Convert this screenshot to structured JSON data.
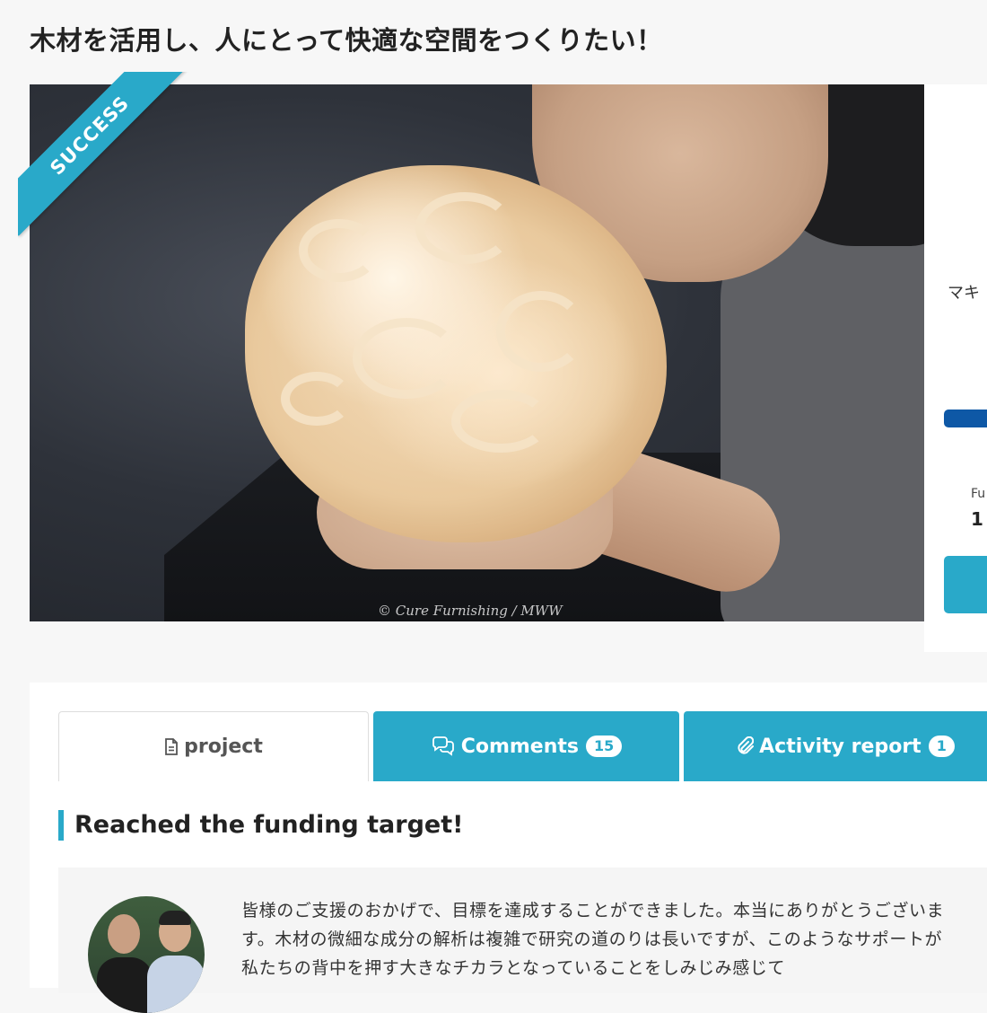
{
  "page": {
    "title": "木材を活用し、人にとって快適な空間をつくりたい！"
  },
  "hero": {
    "ribbon_label": "SUCCESS",
    "photo_credit": "© Cure Furnishing / MWW"
  },
  "side_panel": {
    "owner_partial": "マキ",
    "funding_label_partial": "Fu",
    "funding_value_partial": "1",
    "progress_bar_color": "#0e58a6"
  },
  "tabs": [
    {
      "label": "project",
      "icon": "document-icon",
      "active": true
    },
    {
      "label": "Comments",
      "icon": "comments-icon",
      "badge": "15",
      "active": false
    },
    {
      "label": "Activity report",
      "icon": "paperclip-icon",
      "badge": "1",
      "active": false
    }
  ],
  "section": {
    "heading": "Reached the funding target!"
  },
  "message": {
    "text": "皆様のご支援のおかげで、目標を達成することができました。本当にありがとうございます。木材の微細な成分の解析は複雑で研究の道のりは長いですが、このようなサポートが私たちの背中を押す大きなチカラとなっていることをしみじみ感じて"
  },
  "colors": {
    "accent": "#29a9c9",
    "background": "#f7f7f7",
    "card": "#ffffff"
  }
}
